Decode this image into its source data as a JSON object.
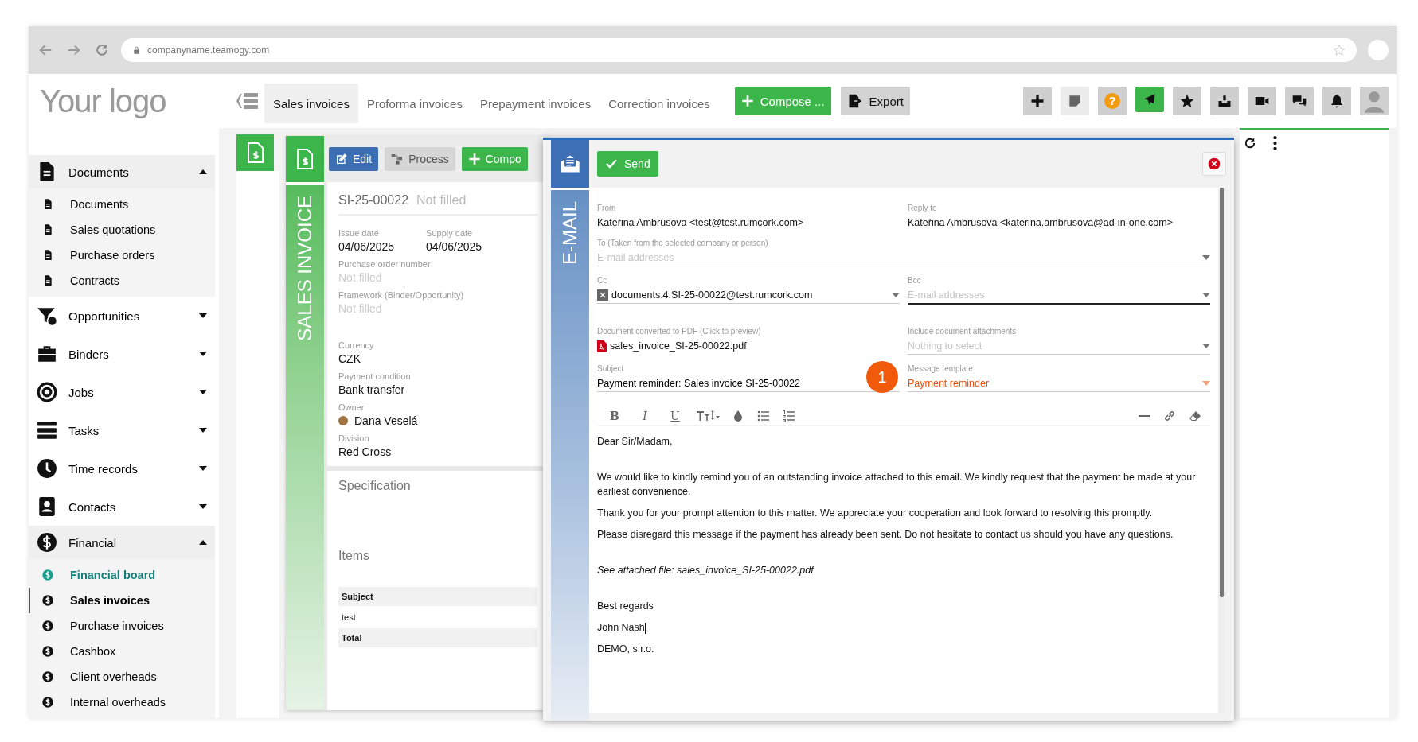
{
  "browser": {
    "url": "companyname.teamogy.com"
  },
  "logo": "Your logo",
  "tabs": [
    {
      "label": "Sales invoices",
      "selected": true
    },
    {
      "label": "Proforma invoices",
      "selected": false
    },
    {
      "label": "Prepayment invoices",
      "selected": false
    },
    {
      "label": "Correction invoices",
      "selected": false
    }
  ],
  "actions": [
    {
      "kind": "compose",
      "label": "Compose ..."
    },
    {
      "kind": "export",
      "label": "Export"
    }
  ],
  "header_buttons": [
    {
      "kind": "plus"
    },
    {
      "kind": "note"
    },
    {
      "kind": "help",
      "glyph": "?"
    },
    {
      "kind": "send"
    },
    {
      "kind": "star"
    },
    {
      "kind": "inbox"
    },
    {
      "kind": "video"
    },
    {
      "kind": "chat"
    },
    {
      "kind": "bell"
    },
    {
      "kind": "avatar"
    }
  ],
  "sidebar": [
    {
      "label": "Documents",
      "expanded": true,
      "children": [
        {
          "label": "Documents",
          "selected": false,
          "highlighted": false
        },
        {
          "label": "Sales quotations",
          "selected": false,
          "highlighted": false
        },
        {
          "label": "Purchase orders",
          "selected": false,
          "highlighted": false
        },
        {
          "label": "Contracts",
          "selected": false,
          "highlighted": false
        }
      ]
    },
    {
      "label": "Opportunities",
      "expanded": false
    },
    {
      "label": "Binders",
      "expanded": false
    },
    {
      "label": "Jobs",
      "expanded": false
    },
    {
      "label": "Tasks",
      "expanded": false
    },
    {
      "label": "Time records",
      "expanded": false
    },
    {
      "label": "Contacts",
      "expanded": false
    },
    {
      "label": "Financial",
      "expanded": true,
      "children": [
        {
          "label": "Financial board",
          "selected": false,
          "highlighted": true
        },
        {
          "label": "Sales invoices",
          "selected": true,
          "highlighted": false
        },
        {
          "label": "Purchase invoices",
          "selected": false,
          "highlighted": false
        },
        {
          "label": "Cashbox",
          "selected": false,
          "highlighted": false
        },
        {
          "label": "Client overheads",
          "selected": false,
          "highlighted": false
        },
        {
          "label": "Internal overheads",
          "selected": false,
          "highlighted": false
        }
      ]
    }
  ],
  "invoice": {
    "vertical_title": "SALES INVOICE",
    "buttons": [
      {
        "kind": "edit",
        "label": "Edit"
      },
      {
        "kind": "process",
        "label": "Process"
      },
      {
        "kind": "compose",
        "label": "Compo"
      }
    ],
    "number": "SI-25-00022",
    "name": "Not filled",
    "dates": [
      {
        "label": "Issue date",
        "value": "04/06/2025"
      },
      {
        "label": "Supply date",
        "value": "04/06/2025"
      }
    ],
    "field_groups": [
      [
        {
          "label": "Purchase order number",
          "value": "Not filled",
          "filled": false
        },
        {
          "label": "Framework (Binder/Opportunity)",
          "value": "Not filled",
          "filled": false
        }
      ],
      [
        {
          "label": "Currency",
          "value": "CZK",
          "filled": true
        },
        {
          "label": "Payment condition",
          "value": "Bank transfer",
          "filled": true
        },
        {
          "label": "Owner",
          "value": "Dana Veselá",
          "filled": true,
          "avatar": true
        },
        {
          "label": "Division",
          "value": "Red Cross",
          "filled": true
        }
      ]
    ],
    "specification": "Specification",
    "items": "Items",
    "table": [
      {
        "text": "Subject",
        "kind": "header"
      },
      {
        "text": "test",
        "kind": "row"
      },
      {
        "text": "Total",
        "kind": "footer"
      }
    ]
  },
  "email": {
    "vertical_title": "E-MAIL",
    "send": "Send",
    "from": {
      "label": "From",
      "value": "Kateřina Ambrusova <test@test.rumcork.com>"
    },
    "reply_to": {
      "label": "Reply to",
      "value": "Kateřina Ambrusova <katerina.ambrusova@ad-in-one.com>"
    },
    "to": {
      "label": "To (Taken from the selected company or person)",
      "placeholder": "E-mail addresses"
    },
    "cc": {
      "label": "Cc",
      "chip": "documents.4.SI-25-00022@test.rumcork.com"
    },
    "bcc": {
      "label": "Bcc",
      "placeholder": "E-mail addresses"
    },
    "pdf": {
      "label": "Document converted to PDF (Click to preview)",
      "file": "sales_invoice_SI-25-00022.pdf"
    },
    "attachments": {
      "label": "Include document attachments",
      "placeholder": "Nothing to select"
    },
    "subject": {
      "label": "Subject",
      "value": "Payment reminder: Sales invoice SI-25-00022"
    },
    "template": {
      "label": "Message template",
      "value": "Payment reminder"
    },
    "callout": "1",
    "editor_format": [
      {
        "kind": "bold",
        "glyph": "B"
      },
      {
        "kind": "italic",
        "glyph": "I"
      },
      {
        "kind": "underline",
        "glyph": "U"
      }
    ],
    "body": [
      [
        {
          "text": "Dear Sir/Madam,",
          "italic": false,
          "cursor": false
        }
      ],
      [
        {
          "text": "We would like to kindly remind you of an outstanding invoice attached to this email. We kindly request that the payment be made at your earliest convenience.",
          "italic": false,
          "cursor": false
        },
        {
          "text": "Thank you for your prompt attention to this matter. We appreciate your cooperation and look forward to resolving this promptly.",
          "italic": false,
          "cursor": false
        },
        {
          "text": "Please disregard this message if the payment has already been sent. Do not hesitate to contact us should you have any questions.",
          "italic": false,
          "cursor": false
        }
      ],
      [
        {
          "text": "See attached file: sales_invoice_SI-25-00022.pdf",
          "italic": true,
          "cursor": false
        }
      ],
      [
        {
          "text": "Best regards",
          "italic": false,
          "cursor": false
        },
        {
          "text": "John Nash",
          "italic": false,
          "cursor": true
        },
        {
          "text": "DEMO, s.r.o.",
          "italic": false,
          "cursor": false
        }
      ]
    ]
  }
}
